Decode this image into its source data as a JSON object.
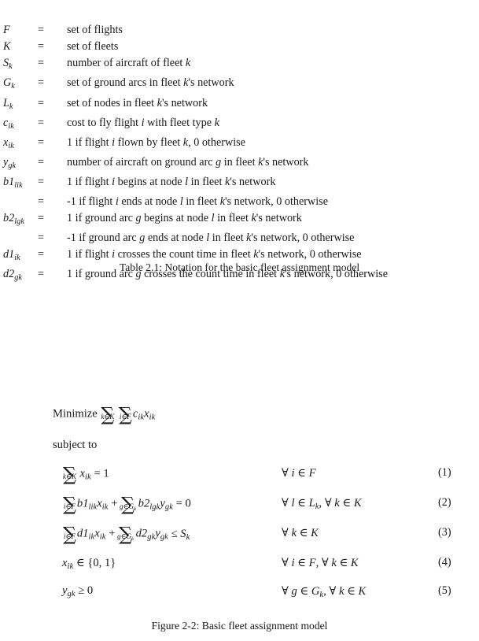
{
  "document": {
    "type": "thesis-page",
    "background_color": "#ffffff",
    "text_color": "#1a1a1a"
  },
  "notation_table": {
    "caption": "Table 2.1: Notation for the basic fleet assignment model",
    "equals_sign": "=",
    "rows": [
      {
        "symbol_base": "F",
        "symbol_sub": "",
        "desc": "set of flights"
      },
      {
        "symbol_base": "K",
        "symbol_sub": "",
        "desc": "set of fleets"
      },
      {
        "symbol_base": "S",
        "symbol_sub": "k",
        "desc": "number of aircraft of fleet k"
      },
      {
        "symbol_base": "G",
        "symbol_sub": "k",
        "desc": "set of ground arcs in fleet k's network"
      },
      {
        "symbol_base": "L",
        "symbol_sub": "k",
        "desc": "set of nodes in fleet k's network"
      },
      {
        "symbol_base": "c",
        "symbol_sub": "ik",
        "desc": "cost to fly flight i with fleet type k"
      },
      {
        "symbol_base": "x",
        "symbol_sub": "ik",
        "desc": "1 if flight i flown by fleet k, 0 otherwise"
      },
      {
        "symbol_base": "y",
        "symbol_sub": "gk",
        "desc": "number of aircraft on ground arc g in fleet k's network"
      },
      {
        "symbol_base": "b1",
        "symbol_sub": "lik",
        "desc": "1 if flight i begins at node l in fleet k's network"
      },
      {
        "symbol_base": "",
        "symbol_sub": "",
        "desc": "-1 if flight i ends at node l in fleet k's network, 0 otherwise"
      },
      {
        "symbol_base": "b2",
        "symbol_sub": "lgk",
        "desc": "1 if ground arc g begins at node l in fleet k's network"
      },
      {
        "symbol_base": "",
        "symbol_sub": "",
        "desc": "-1 if ground arc g ends at node l in fleet k's network, 0 otherwise"
      },
      {
        "symbol_base": "d1",
        "symbol_sub": "ik",
        "desc": "1 if flight i crosses the count time in fleet k's network, 0 otherwise"
      },
      {
        "symbol_base": "d2",
        "symbol_sub": "gk",
        "desc": "1 if ground arc g crosses the count time in fleet k's network, 0 otherwise"
      }
    ]
  },
  "model": {
    "caption": "Figure 2-2: Basic fleet assignment model",
    "objective_label": "Minimize",
    "objective_sum1_limit": "k∈K",
    "objective_sum2_limit": "i∈F",
    "objective_term_base": "c",
    "objective_term_sub": "ik",
    "objective_term2_base": "x",
    "objective_term2_sub": "ik",
    "subject_to_label": "subject to",
    "sum_glyph": "∑",
    "constraints": [
      {
        "number": "(1)",
        "qualifier": "∀ i ∈ F",
        "sum1_limit": "k∈K",
        "lhs_term1": "x",
        "lhs_term1_sub": "ik",
        "relation": "= 1"
      },
      {
        "number": "(2)",
        "qualifier": "∀ l ∈ L_k, ∀ k ∈ K",
        "sum1_limit": "i∈F",
        "lhs_term1": "b1",
        "lhs_term1_sub": "lik",
        "lhs_term1b": "x",
        "lhs_term1b_sub": "ik",
        "plus": "+",
        "sum2_limit": "g∈G_k",
        "lhs_term2": "b2",
        "lhs_term2_sub": "lgk",
        "lhs_term2b": "y",
        "lhs_term2b_sub": "gk",
        "relation": "= 0"
      },
      {
        "number": "(3)",
        "qualifier": "∀ k ∈ K",
        "sum1_limit": "i∈F",
        "lhs_term1": "d1",
        "lhs_term1_sub": "ik",
        "lhs_term1b": "x",
        "lhs_term1b_sub": "ik",
        "plus": "+",
        "sum2_limit": "g∈G_k",
        "lhs_term2": "d2",
        "lhs_term2_sub": "gk",
        "lhs_term2b": "y",
        "lhs_term2b_sub": "gk",
        "relation": "≤ S_k"
      },
      {
        "number": "(4)",
        "qualifier": "∀ i ∈ F, ∀ k ∈ K",
        "lhs_term1": "x",
        "lhs_term1_sub": "ik",
        "relation": "∈ {0, 1}"
      },
      {
        "number": "(5)",
        "qualifier": "∀ g ∈ G_k, ∀ k ∈ K",
        "lhs_term1": "y",
        "lhs_term1_sub": "gk",
        "relation": "≥ 0"
      }
    ]
  }
}
